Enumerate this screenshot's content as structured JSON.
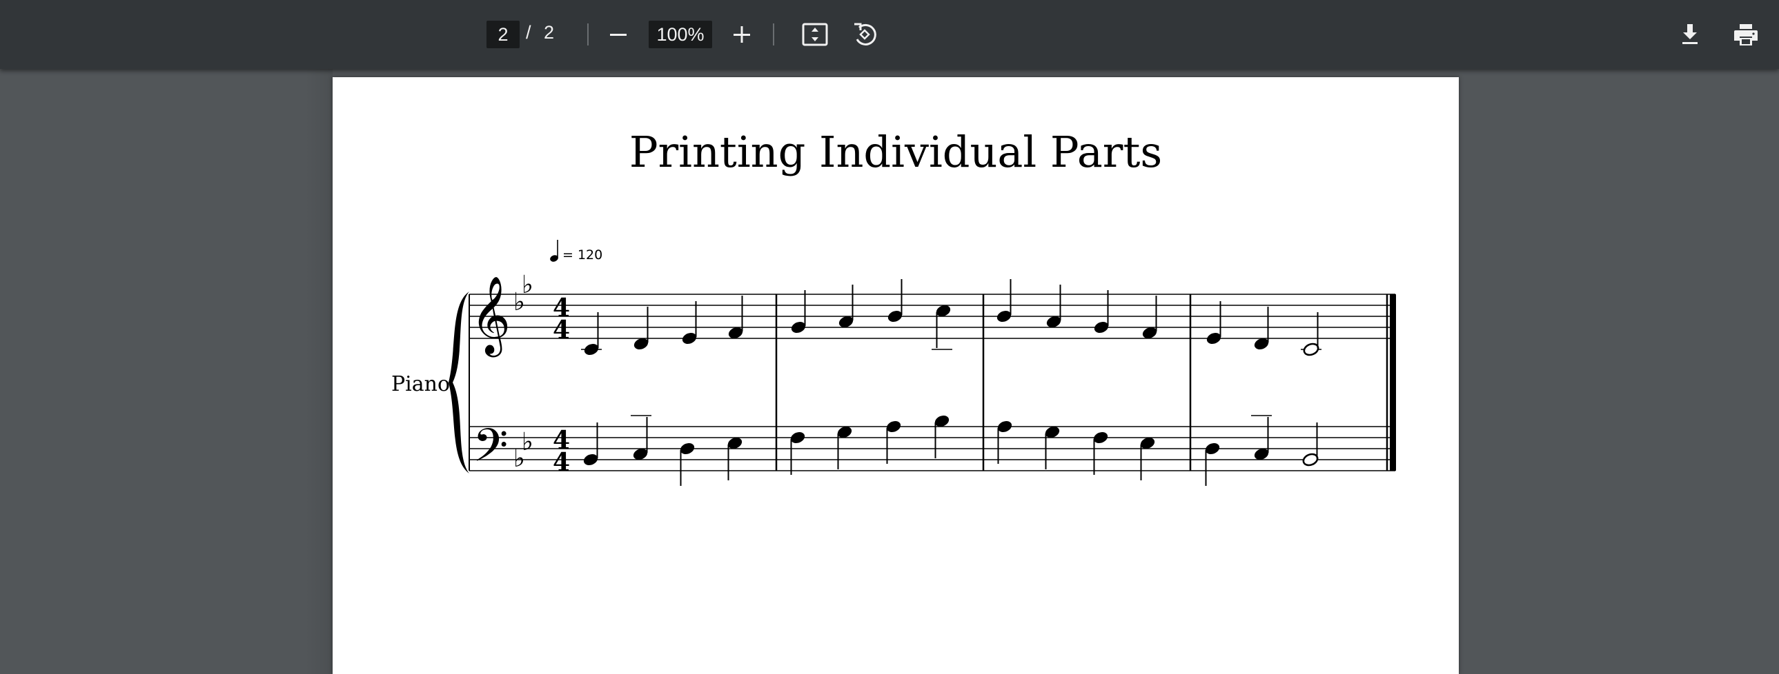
{
  "toolbar": {
    "current_page": "2",
    "page_separator": "/",
    "total_pages": "2",
    "zoom_level": "100%",
    "icons": {
      "zoom_out": "minus-icon",
      "zoom_in": "plus-icon",
      "fit": "fit-to-page-icon",
      "rotate": "rotate-icon",
      "download": "download-icon",
      "print": "print-icon"
    }
  },
  "document": {
    "title": "Printing Individual Parts",
    "tempo_marking": "= 120",
    "instrument": "Piano",
    "key_signature": "two flats",
    "time_signature": "4/4",
    "measures": 4
  },
  "colors": {
    "toolbar_bg": "#323639",
    "viewer_bg": "#525659",
    "page_bg": "#ffffff",
    "input_bg": "#191b1c"
  }
}
